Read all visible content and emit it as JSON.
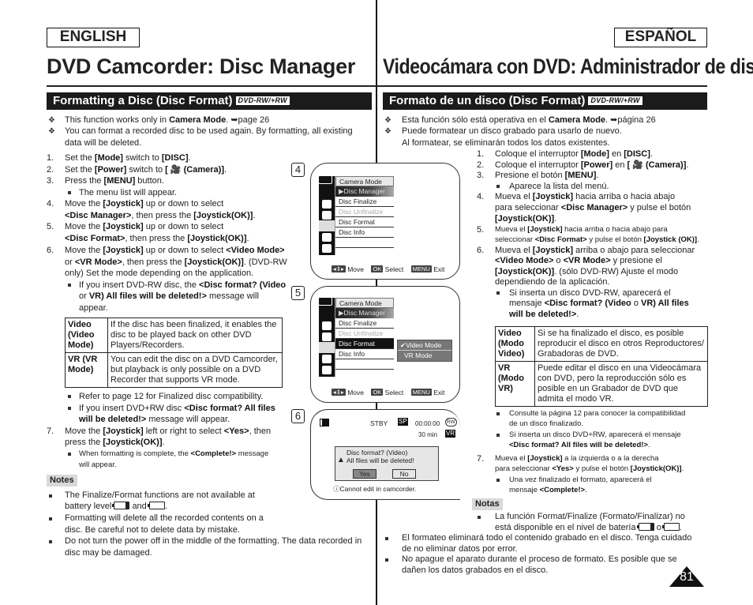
{
  "page": {
    "number": "81"
  },
  "english": {
    "lang_label": "ENGLISH",
    "title": "DVD Camcorder: Disc Manager",
    "section_title": "Formatting a Disc (Disc Format)",
    "badge": "DVD-RW/+RW",
    "intro": [
      {
        "pre": "This function works only in ",
        "bold": "Camera Mode",
        "post": ". ➥page 26"
      },
      {
        "line1": "You can format a recorded disc to be used again. By formatting, all existing",
        "line2": "data will be deleted."
      }
    ],
    "steps": {
      "s1": {
        "n": "1.",
        "a": "Set the ",
        "b": "[Mode]",
        "c": " switch to ",
        "d": "[DISC]",
        "e": "."
      },
      "s2": {
        "n": "2.",
        "a": "Set the ",
        "b": "[Power]",
        "c": " switch to ",
        "d": "[ 🎥 (Camera)]",
        "e": "."
      },
      "s3": {
        "n": "3.",
        "a": "Press the ",
        "b": "[MENU]",
        "c": " button.",
        "sub": "The menu list will appear."
      },
      "s4": {
        "n": "4.",
        "a": "Move the ",
        "b": "[Joystick]",
        "c": " up or down to select",
        "d": "<Disc Manager>",
        "e": ", then press the ",
        "f": "[Joystick(OK)]",
        "g": "."
      },
      "s5": {
        "n": "5.",
        "a": "Move the ",
        "b": "[Joystick]",
        "c": " up or down to select",
        "d": "<Disc Format>",
        "e": ", then press the ",
        "f": "[Joystick(OK)]",
        "g": "."
      },
      "s6": {
        "n": "6.",
        "a": "Move the ",
        "b": "[Joystick]",
        "c": " up or down to select ",
        "d": "<Video Mode>",
        "e": "or ",
        "f": "<VR Mode>",
        "g": ", then press the ",
        "h": "[Joystick(OK)]",
        "i": ". (DVD-RW",
        "j": "only) Set the mode depending on the application.",
        "sub1": "If you insert DVD-RW disc, the ",
        "sub1b": "<Disc format? (Video",
        "sub2a": "or ",
        "sub2b": "VR) All files will be deleted!>",
        "sub2c": " message will",
        "sub3": "appear."
      },
      "s7": {
        "n": "7.",
        "a": "Move the ",
        "b": "[Joystick]",
        "c": " left or right to select ",
        "d": "<Yes>",
        "e": ", then",
        "f": "press the ",
        "g": "[Joystick(OK)]",
        "h": ".",
        "sub1a": "When formatting is complete, the ",
        "sub1b": "<Complete!>",
        "sub1c": " message",
        "sub2": "will appear."
      }
    },
    "table": [
      {
        "key": "Video (Video Mode)",
        "value": "If the disc has been finalized, it enables the disc to be played back on other DVD Players/Recorders."
      },
      {
        "key": "VR (VR Mode)",
        "value": "You can edit the disc on a DVD Camcorder, but playback is only possible on a DVD Recorder that supports VR mode."
      }
    ],
    "after_table": {
      "b1": "Refer to page 12 for Finalized disc compatibility.",
      "b2a": "If you insert DVD+RW disc ",
      "b2b": "<Disc format? All files",
      "b2c": "will be deleted!>",
      "b2d": " message will appear."
    },
    "notes_label": "Notes",
    "notes": {
      "n1a": "The Finalize/Format functions are not available at",
      "n1b": "battery level",
      "n1c": "and",
      "n1d": ".",
      "n2a": "Formatting will delete all the recorded contents on a",
      "n2b": "disc. Be careful not to delete data by mistake.",
      "n3a": "Do not turn the power off in the middle of the formatting. The data recorded in",
      "n3b": "disc may be damaged."
    }
  },
  "spanish": {
    "lang_label": "ESPAÑOL",
    "title": "Videocámara con DVD: Administrador de discos",
    "section_title": "Formato de un disco (Disc Format)",
    "badge": "DVD-RW/+RW",
    "intro": {
      "i1a": "Esta función sólo está operativa en el ",
      "i1b": "Camera Mode",
      "i1c": ". ➥página 26",
      "i2a": "Puede formatear un disco grabado para usarlo de nuevo.",
      "i2b": "Al formatear, se eliminarán todos los datos existentes."
    },
    "steps": {
      "s1": {
        "n": "1.",
        "a": "Coloque el interruptor ",
        "b": "[Mode]",
        "c": " en ",
        "d": "[DISC]",
        "e": "."
      },
      "s2": {
        "n": "2.",
        "a": "Coloque el interruptor ",
        "b": "[Power]",
        "c": " en ",
        "d": "[ 🎥 (Camera)]",
        "e": "."
      },
      "s3": {
        "n": "3.",
        "a": "Presione el botón ",
        "b": "[MENU]",
        "c": ".",
        "sub": "Aparece la lista del menú."
      },
      "s4": {
        "n": "4.",
        "a": "Mueva el ",
        "b": "[Joystick]",
        "c": " hacia arriba o hacia abajo",
        "d": "para seleccionar ",
        "e": "<Disc Manager>",
        "f": " y pulse el botón",
        "g": "[Joystick(OK)]",
        "h": "."
      },
      "s5": {
        "n": "5.",
        "a": "Mueva el ",
        "b": "[Joystick]",
        "c": " hacia arriba o hacia abajo para",
        "d": "seleccionar ",
        "e": "<Disc Format>",
        "f": " y pulse el botón ",
        "g": "[Joystick (OK)]",
        "h": "."
      },
      "s6": {
        "n": "6.",
        "a": "Mueva el ",
        "b": "[Joystick]",
        "c": " arriba o abajo para seleccionar",
        "d": "<Video Mode>",
        "e": " o ",
        "f": "<VR Mode>",
        "g": " y presione el",
        "h": "[Joystick(OK)]",
        "i": ". (sólo DVD-RW) Ajuste el modo",
        "j": "dependiendo de la aplicación.",
        "sub1": "Si inserta un disco DVD-RW, aparecerá el",
        "sub2a": "mensaje ",
        "sub2b": "<Disc format? (Video",
        "sub2c": " o ",
        "sub2d": "VR) All files",
        "sub3": "will be deleted!>",
        "sub3b": "."
      },
      "s7": {
        "n": "7.",
        "a": "Mueva el ",
        "b": "[Joystick]",
        "c": " a la izquierda o a la derecha",
        "d": "para seleccionar ",
        "e": "<Yes>",
        "f": " y pulse el botón ",
        "g": "[Joystick(OK)]",
        "h": ".",
        "sub1": "Una vez finalizado el formato, aparecerá el",
        "sub2a": "mensaje ",
        "sub2b": "<Complete!>",
        "sub2c": "."
      }
    },
    "table": [
      {
        "key": "Video (Modo Video)",
        "value": "Si se ha finalizado el disco, es posible reproducir el disco en otros Reproductores/ Grabadoras de DVD."
      },
      {
        "key": "VR (Modo VR)",
        "value": "Puede editar el disco en una Videocámara con DVD, pero la reproducción sólo es posible en un Grabador de DVD que admita el modo VR."
      }
    ],
    "after_table": {
      "b1a": "Consulte la página 12 para conocer la compatibilidad",
      "b1b": "de un disco finalizado.",
      "b2a": "Si inserta un disco DVD+RW, aparecerá el mensaje",
      "b2b": "<Disc format? All files will be deleted!>",
      "b2c": "."
    },
    "notes_label": "Notas",
    "notes": {
      "n1a": "La función Format/Finalize (Formato/Finalizar) no",
      "n1b": "está disponible en el nivel de batería",
      "n1c": "o",
      "n1d": ".",
      "n2a": "El formateo eliminará todo el contenido grabado en el disco. Tenga cuidado",
      "n2b": "de no eliminar datos por error.",
      "n3a": "No apague el aparato durante el proceso de formato. Es posible que se",
      "n3b": "dañen los datos grabados en el disco."
    }
  },
  "screens": {
    "menu_header": "Camera Mode",
    "menu_items": [
      "▶Disc Manager",
      "Disc Finalize",
      "Disc Unfinalize",
      "Disc Format",
      "Disc Info"
    ],
    "footer": {
      "move": "Move",
      "ok_chip": "OK",
      "select": "Select",
      "menu_chip": "MENU",
      "exit": "Exit"
    },
    "step4": {
      "num": "4"
    },
    "step5": {
      "num": "5",
      "submenu": [
        "✔Video Mode",
        "VR Mode"
      ]
    },
    "step6": {
      "num": "6",
      "status": "STBY",
      "quality": "SP",
      "timecode": "00:00:00",
      "disc_type": "RW",
      "remaining": "30 min",
      "format": "VR",
      "dialog_line1": "Disc format? (Video)",
      "dialog_line2": "All files will be deleted!",
      "yes": "Yes",
      "no": "No",
      "info": "Cannot edit in camcorder."
    }
  }
}
